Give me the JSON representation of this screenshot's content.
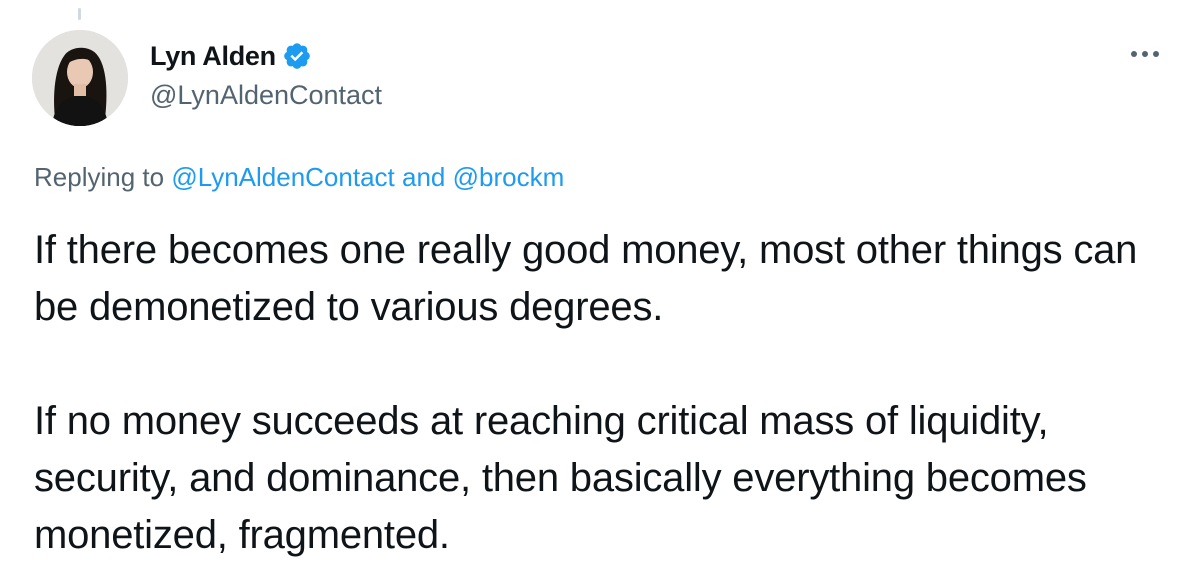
{
  "tweet": {
    "author": {
      "display_name": "Lyn Alden",
      "handle": "@LynAldenContact",
      "verified": true
    },
    "reply_context": {
      "prefix": "Replying to",
      "mention_1": "@LynAldenContact",
      "conjunction": "and",
      "mention_2": "@brockm"
    },
    "paragraphs": [
      "If there becomes one really good money, most other things can be demonetized to various degrees.",
      "If no money succeeds at reaching critical mass of liquidity, security, and dominance, then basically everything becomes monetized, fragmented."
    ]
  },
  "icons": {
    "avatar": "profile-photo",
    "verified": "verified-badge-icon",
    "more": "more-options-icon"
  },
  "colors": {
    "link": "#1d9bf0",
    "verified_badge": "#1d9bf0",
    "secondary_text": "#536471",
    "primary_text": "#0f1419",
    "thread_line": "#cfd9de"
  }
}
